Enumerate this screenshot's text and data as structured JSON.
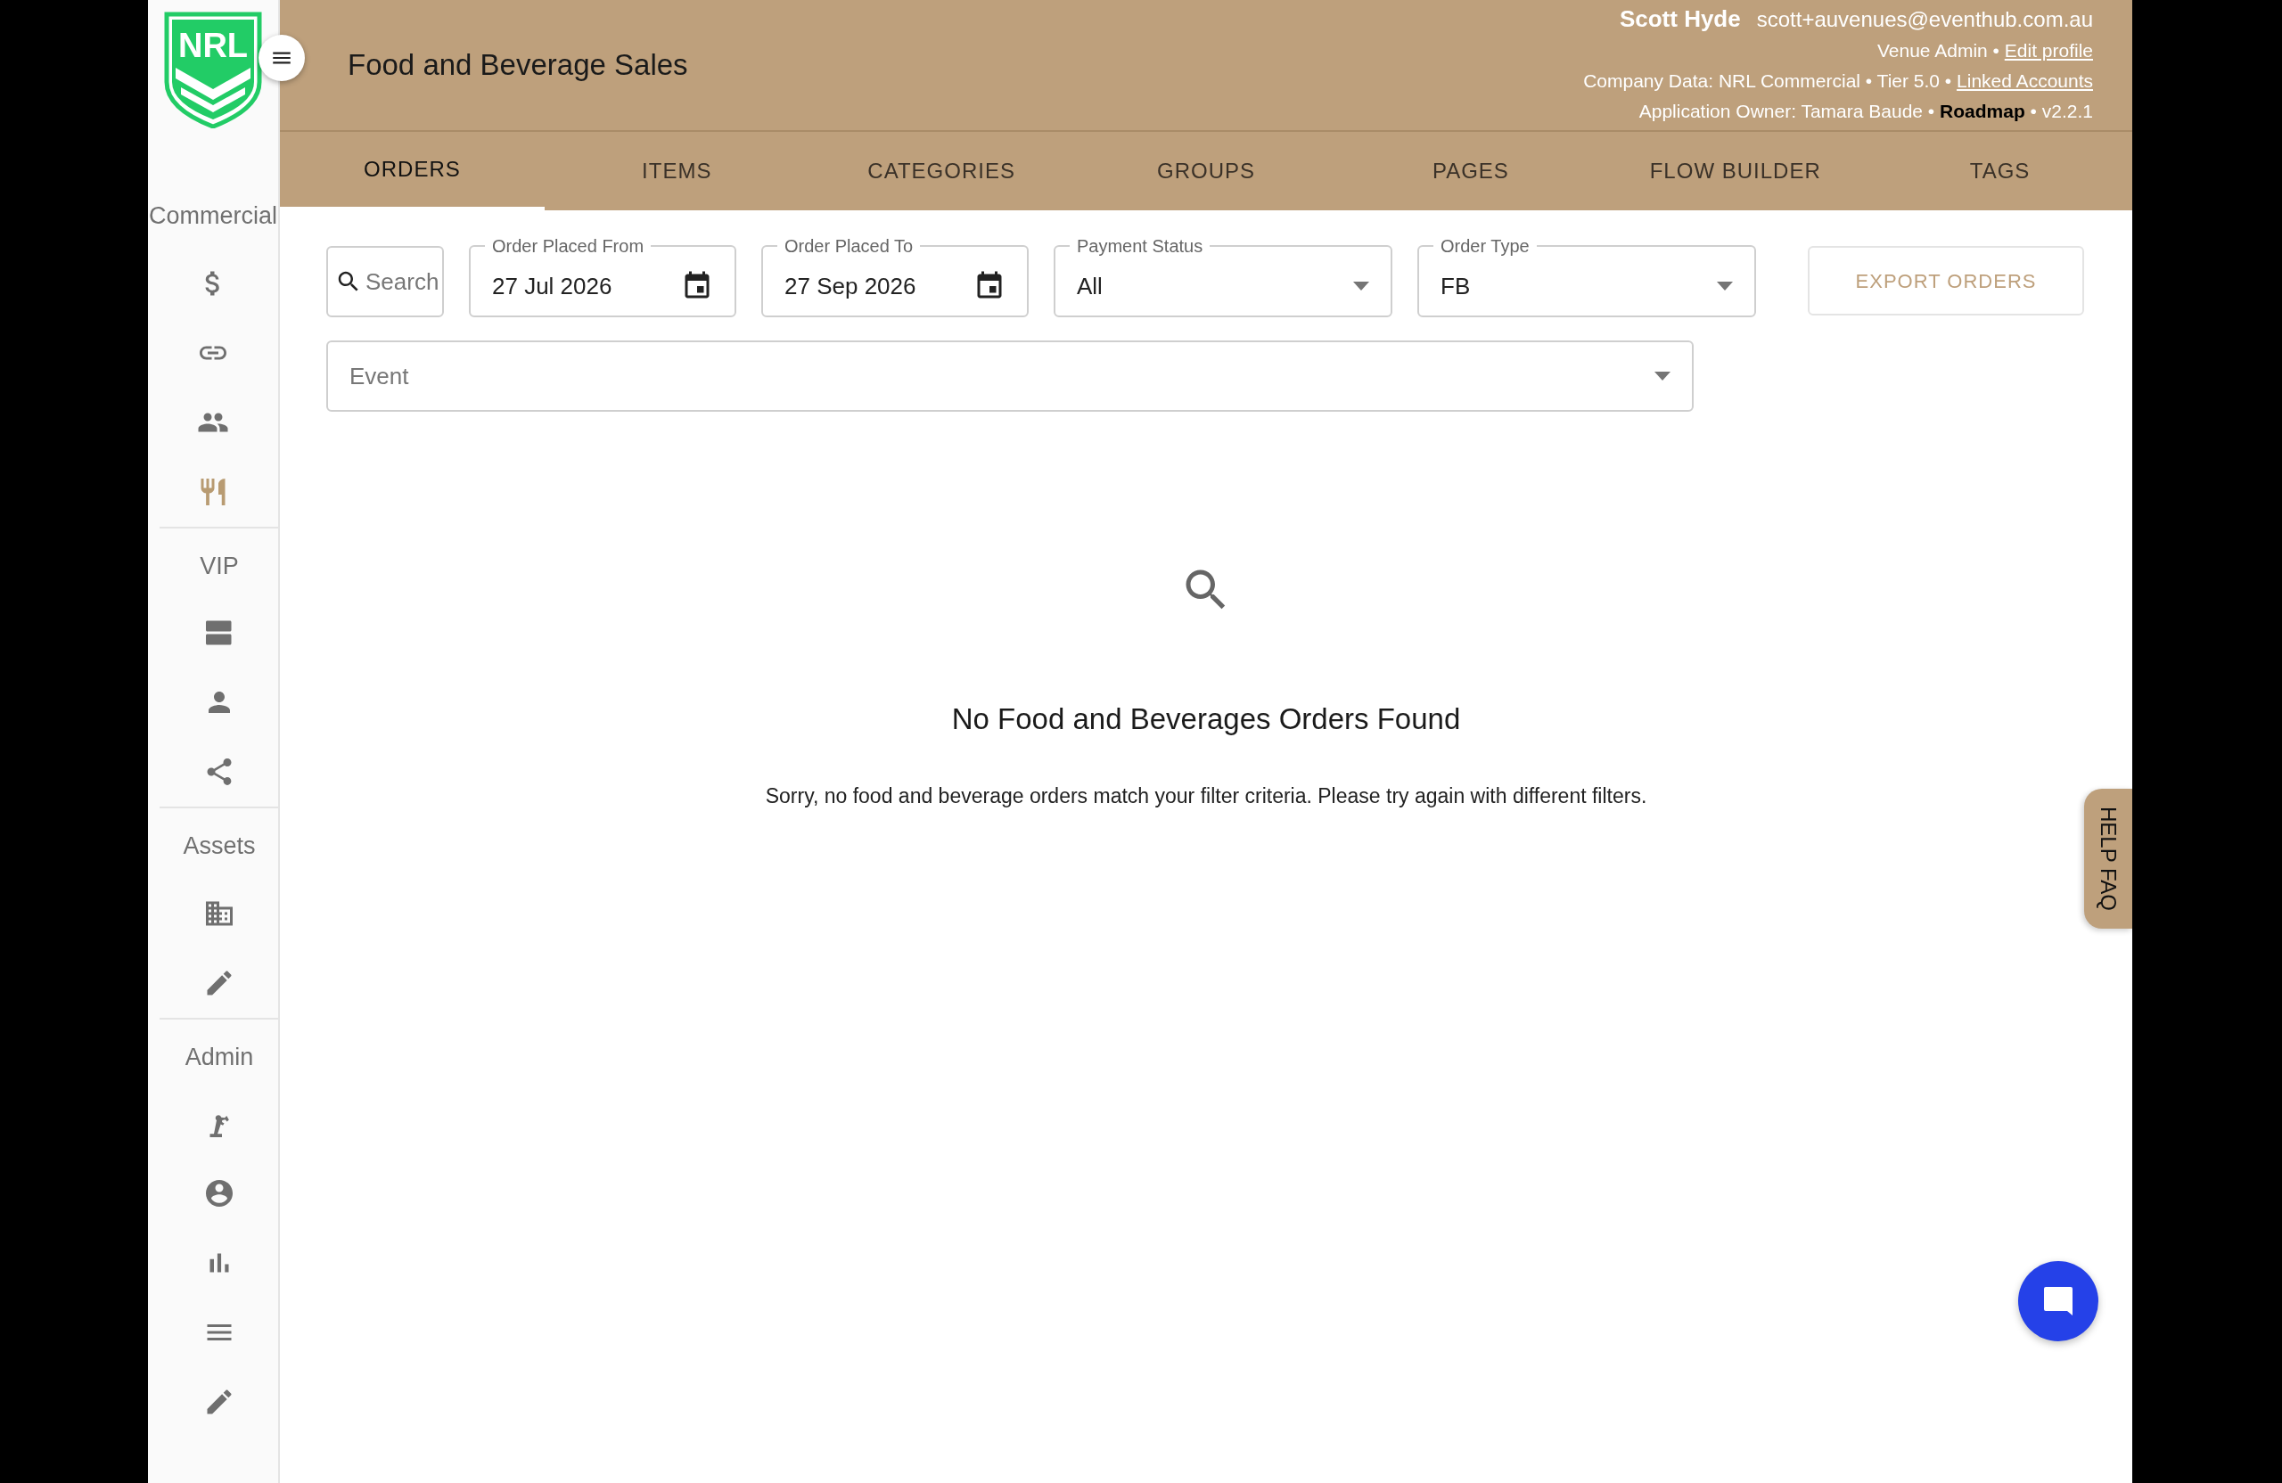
{
  "sidebar": {
    "logo": "NRL",
    "sections": [
      {
        "label": "Commercial",
        "items": [
          {
            "selected": false
          },
          {
            "selected": false
          },
          {
            "selected": false
          },
          {
            "selected": true
          }
        ]
      },
      {
        "label": "VIP",
        "items": [
          {
            "selected": false
          },
          {
            "selected": false
          },
          {
            "selected": false
          }
        ]
      },
      {
        "label": "Assets",
        "items": [
          {
            "selected": false
          },
          {
            "selected": false
          }
        ]
      },
      {
        "label": "Admin",
        "items": [
          {
            "selected": false
          },
          {
            "selected": false
          },
          {
            "selected": false
          },
          {
            "selected": false
          },
          {
            "selected": false
          }
        ]
      }
    ]
  },
  "header": {
    "title": "Food and Beverage Sales",
    "user_name": "Scott Hyde",
    "email": "scott+auvenues@eventhub.com.au",
    "role": "Venue Admin •",
    "edit_profile": "Edit profile",
    "company": "Company Data: NRL Commercial • Tier 5.0 •",
    "linked_accounts": "Linked Accounts",
    "owner": "Application Owner: Tamara Baude •",
    "roadmap": "Roadmap",
    "version": "• v2.2.1"
  },
  "tabs": [
    {
      "label": "ORDERS",
      "selected": true
    },
    {
      "label": "ITEMS",
      "selected": false
    },
    {
      "label": "CATEGORIES",
      "selected": false
    },
    {
      "label": "GROUPS",
      "selected": false
    },
    {
      "label": "PAGES",
      "selected": false
    },
    {
      "label": "FLOW BUILDER",
      "selected": false
    },
    {
      "label": "TAGS",
      "selected": false
    }
  ],
  "filters": {
    "search": {
      "placeholder": "Search"
    },
    "fields": [
      {
        "kind": "date",
        "label": "Order Placed From",
        "value": "27 Jul 2026"
      },
      {
        "kind": "date",
        "label": "Order Placed To",
        "value": "27 Sep 2026"
      },
      {
        "kind": "select",
        "label": "Payment Status",
        "value": "All"
      },
      {
        "kind": "select",
        "label": "Order Type",
        "value": "FB"
      }
    ],
    "export_button": "EXPORT ORDERS",
    "event": {
      "placeholder": "Event"
    }
  },
  "empty_state": {
    "title": "No Food and Beverages Orders Found",
    "message": "Sorry, no food and beverage orders match your filter criteria. Please try again with different filters."
  },
  "help_tab": "HELP FAQ"
}
